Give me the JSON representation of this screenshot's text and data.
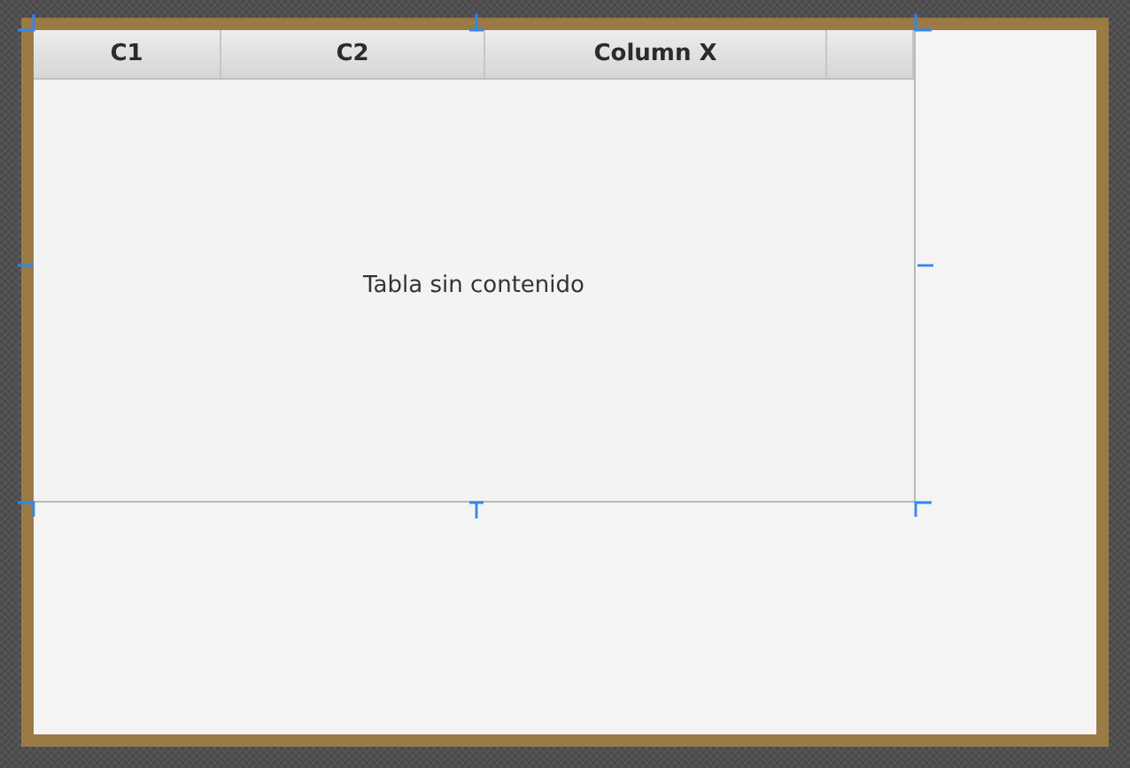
{
  "table": {
    "columns": [
      {
        "label": "C1",
        "kind": "column"
      },
      {
        "label": "C2",
        "kind": "column"
      },
      {
        "label": "Column X",
        "kind": "column"
      },
      {
        "kind": "filler"
      }
    ],
    "placeholder": "Tabla sin contenido"
  }
}
